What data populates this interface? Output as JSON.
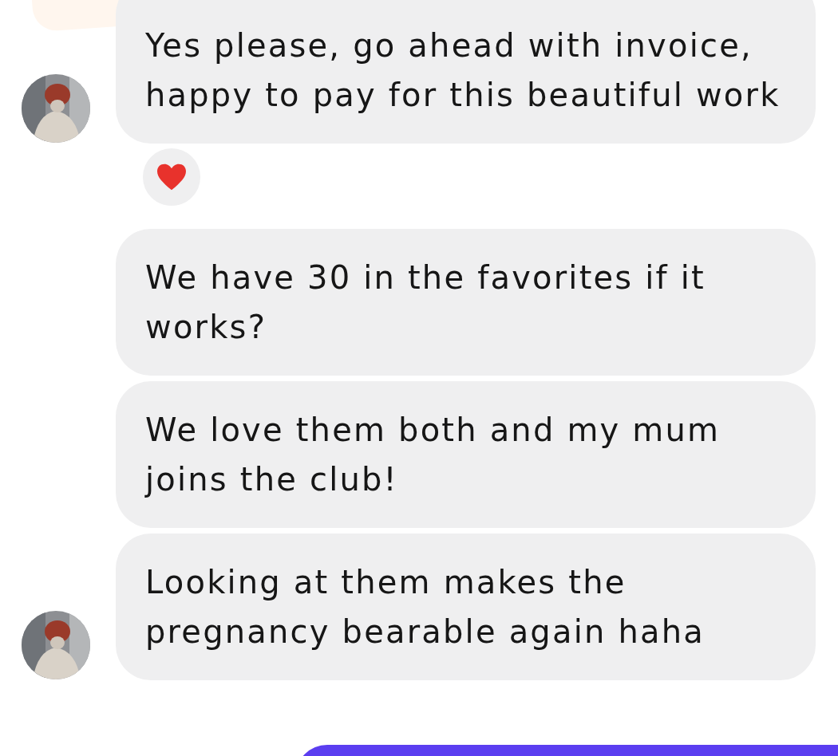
{
  "messages": [
    {
      "text": "Yes please, go ahead with invoice, happy to pay for this beautiful work",
      "avatar": true,
      "reacted": true
    },
    {
      "text": "We have 30 in the favorites if it works?",
      "avatar": false,
      "reacted": false
    },
    {
      "text": "We love them both and my mum joins the club!",
      "avatar": false,
      "reacted": false
    },
    {
      "text": "Looking at them makes the pregnancy bearable again haha",
      "avatar": true,
      "reacted": false
    }
  ]
}
